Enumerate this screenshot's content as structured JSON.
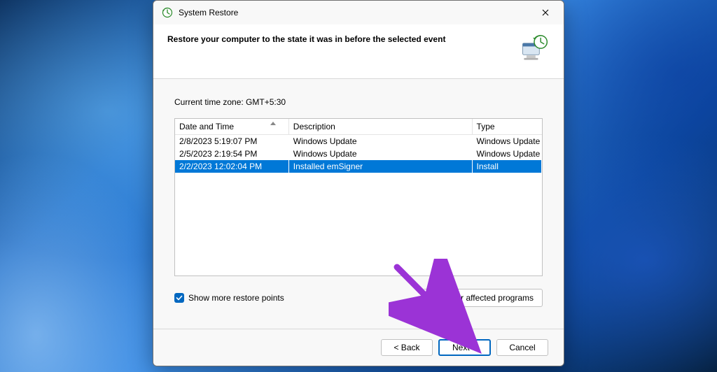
{
  "window": {
    "title": "System Restore"
  },
  "header": {
    "headline": "Restore your computer to the state it was in before the selected event"
  },
  "timezone_label": "Current time zone: GMT+5:30",
  "table": {
    "columns": {
      "date": "Date and Time",
      "desc": "Description",
      "type": "Type"
    },
    "rows": [
      {
        "date": "2/8/2023 5:19:07 PM",
        "desc": "Windows Update",
        "type": "Windows Update",
        "selected": false
      },
      {
        "date": "2/5/2023 2:19:54 PM",
        "desc": "Windows Update",
        "type": "Windows Update",
        "selected": false
      },
      {
        "date": "2/2/2023 12:02:04 PM",
        "desc": "Installed emSigner",
        "type": "Install",
        "selected": true
      }
    ]
  },
  "options": {
    "show_more_label": "Show more restore points",
    "show_more_checked": true,
    "scan_button": "Scan for affected programs"
  },
  "footer": {
    "back": "< Back",
    "next": "Next >",
    "cancel": "Cancel"
  },
  "annotation": {
    "arrow_color": "#9b33d6"
  }
}
